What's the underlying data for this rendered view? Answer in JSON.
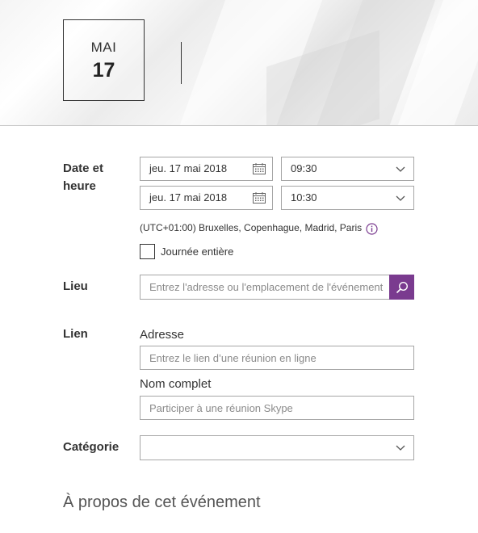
{
  "header": {
    "month": "MAI",
    "day": "17"
  },
  "datetime": {
    "label": "Date et heure",
    "start_date": "jeu. 17 mai 2018",
    "start_time": "09:30",
    "end_date": "jeu. 17 mai 2018",
    "end_time": "10:30",
    "timezone": "(UTC+01:00) Bruxelles, Copenhague, Madrid, Paris",
    "all_day_label": "Journée entière",
    "all_day_checked": false
  },
  "location": {
    "label": "Lieu",
    "placeholder": "Entrez l'adresse ou l'emplacement de l'événement"
  },
  "link": {
    "label": "Lien",
    "address_label": "Adresse",
    "address_placeholder": "Entrez le lien d’une réunion en ligne",
    "name_label": "Nom complet",
    "name_placeholder": "Participer à une réunion Skype"
  },
  "category": {
    "label": "Catégorie",
    "value": ""
  },
  "about": {
    "title": "À propos de cet événement"
  },
  "colors": {
    "accent": "#7a3b8f",
    "border": "#a6a6a6",
    "text": "#333333"
  },
  "icons": {
    "calendar": "calendar-icon",
    "chevron": "chevron-down-icon",
    "info": "info-icon",
    "search": "search-icon"
  }
}
